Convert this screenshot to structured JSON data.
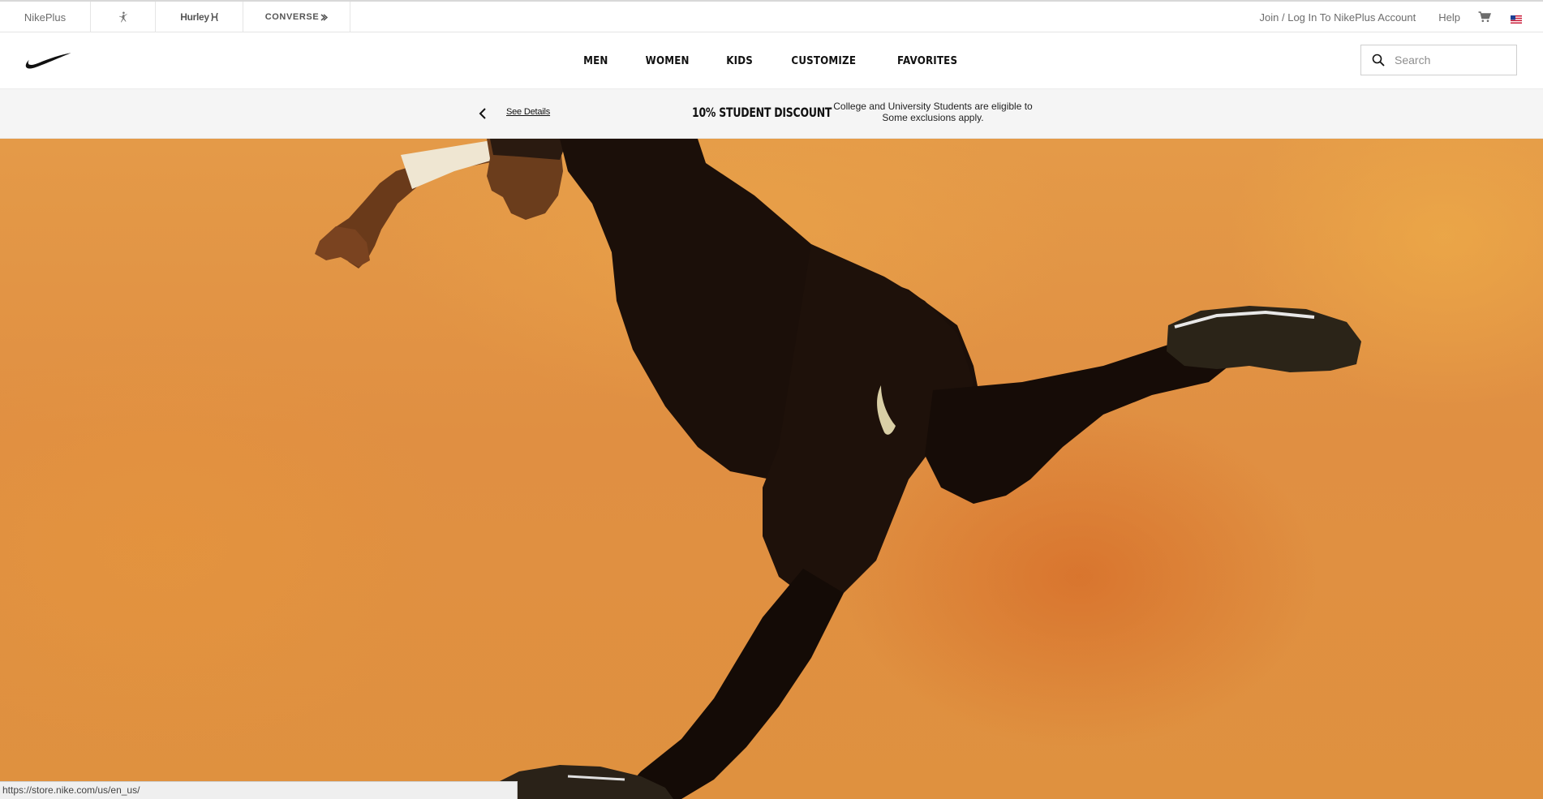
{
  "utility_bar": {
    "brands": [
      {
        "label": "NikePlus",
        "icon": "nikeplus-text"
      },
      {
        "label": "",
        "icon": "jordan-jumpman-icon"
      },
      {
        "label": "Hurley",
        "icon": "hurley-logo"
      },
      {
        "label": "CONVERSE",
        "icon": "converse-logo"
      }
    ],
    "account_label": "Join / Log In To NikePlus Account",
    "help_label": "Help",
    "cart_icon": "cart-icon",
    "flag_icon": "us-flag-icon"
  },
  "header": {
    "logo_icon": "nike-swoosh-icon",
    "nav": [
      "MEN",
      "WOMEN",
      "KIDS",
      "CUSTOMIZE",
      "FAVORITES"
    ],
    "search": {
      "placeholder": "Search",
      "value": "",
      "icon": "search-icon"
    }
  },
  "promo": {
    "prev_icon": "chevron-left-icon",
    "details_label": "See Details",
    "title": "10% STUDENT DISCOUNT",
    "line1": "College and University Students are eligible to",
    "line2": "Some exclusions apply."
  },
  "hero": {
    "background_color": "#e0913f",
    "accent_color": "#d46a2a"
  },
  "status_bar": {
    "url": "https://store.nike.com/us/en_us/"
  }
}
